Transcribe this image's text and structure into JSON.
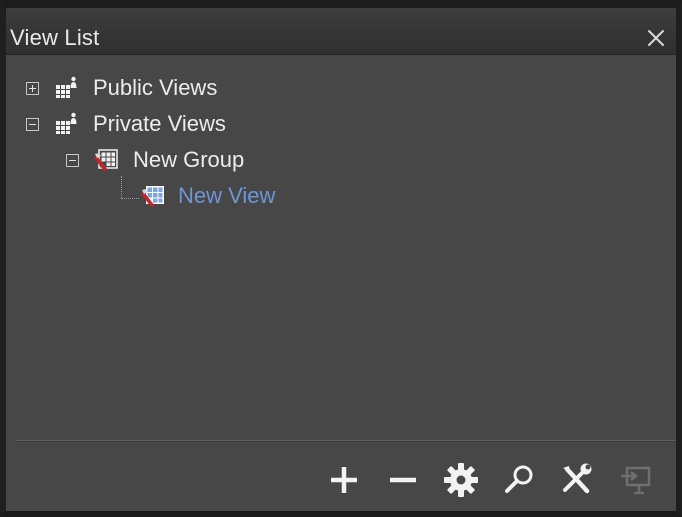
{
  "window": {
    "title": "View List",
    "close_icon": "close-icon"
  },
  "tree": {
    "nodes": [
      {
        "label": "Public Views",
        "state": "collapsed",
        "icon": "views-folder-icon",
        "level": 0
      },
      {
        "label": "Private Views",
        "state": "expanded",
        "icon": "views-folder-icon",
        "level": 0
      },
      {
        "label": "New Group",
        "state": "expanded",
        "icon": "group-icon",
        "level": 1
      },
      {
        "label": "New View",
        "state": "selected",
        "icon": "view-icon",
        "level": 2
      }
    ]
  },
  "toolbar": {
    "buttons": [
      {
        "name": "add",
        "icon": "plus-icon",
        "enabled": true
      },
      {
        "name": "remove",
        "icon": "minus-icon",
        "enabled": true
      },
      {
        "name": "settings",
        "icon": "gear-icon",
        "enabled": true
      },
      {
        "name": "search",
        "icon": "magnifier-icon",
        "enabled": true
      },
      {
        "name": "tools",
        "icon": "tools-icon",
        "enabled": true
      },
      {
        "name": "send-to-monitor",
        "icon": "monitor-import-icon",
        "enabled": false
      }
    ]
  },
  "colors": {
    "panel_bg": "#474747",
    "titlebar_bg": "#353535",
    "text": "#ececec",
    "selected_text": "#6f95d4",
    "icon_white": "#f2f2f2",
    "icon_disabled": "#8a8a8a",
    "group_icon_red": "#c0262b",
    "view_icon_blue": "#7ea5dc"
  }
}
